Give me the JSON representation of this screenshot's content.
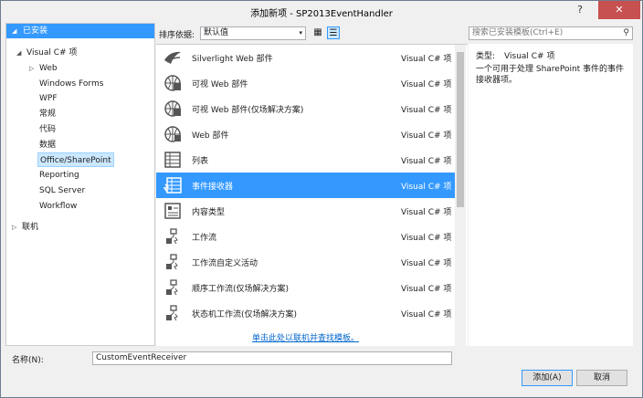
{
  "window": {
    "title": "添加新项 - SP2013EventHandler",
    "help": "?",
    "close": "✕"
  },
  "tree": {
    "installed": "已安装",
    "items": [
      {
        "label": "Visual C# 项",
        "expand": "◢"
      },
      {
        "label": "Web",
        "expand": "▷"
      },
      {
        "label": "Windows Forms"
      },
      {
        "label": "WPF"
      },
      {
        "label": "常规"
      },
      {
        "label": "代码"
      },
      {
        "label": "数据"
      },
      {
        "label": "Office/SharePoint"
      },
      {
        "label": "Reporting"
      },
      {
        "label": "SQL Server"
      },
      {
        "label": "Workflow"
      }
    ],
    "online": "联机",
    "online_expand": "▷"
  },
  "toolbar": {
    "sort_label": "排序依据:",
    "sort_value": "默认值",
    "sort_dropdown": "▾",
    "grid_view": "▦",
    "list_view": "☰",
    "search_placeholder": "搜索已安装模板(Ctrl+E)",
    "search_icon": "⚲"
  },
  "templates": [
    {
      "name": "Silverlight Web 部件",
      "lang": "Visual C# 项",
      "icon": "silverlight-webpart-icon"
    },
    {
      "name": "可视 Web 部件",
      "lang": "Visual C# 项",
      "icon": "visual-webpart-icon"
    },
    {
      "name": "可视 Web 部件(仅场解决方案)",
      "lang": "Visual C# 项",
      "icon": "visual-webpart-farm-icon"
    },
    {
      "name": "Web 部件",
      "lang": "Visual C# 项",
      "icon": "webpart-icon"
    },
    {
      "name": "列表",
      "lang": "Visual C# 项",
      "icon": "list-icon"
    },
    {
      "name": "事件接收器",
      "lang": "Visual C# 项",
      "icon": "event-receiver-icon"
    },
    {
      "name": "内容类型",
      "lang": "Visual C# 项",
      "icon": "content-type-icon"
    },
    {
      "name": "工作流",
      "lang": "Visual C# 项",
      "icon": "workflow-icon"
    },
    {
      "name": "工作流自定义活动",
      "lang": "Visual C# 项",
      "icon": "workflow-activity-icon"
    },
    {
      "name": "顺序工作流(仅场解决方案)",
      "lang": "Visual C# 项",
      "icon": "sequential-workflow-icon"
    },
    {
      "name": "状态机工作流(仅场解决方案)",
      "lang": "Visual C# 项",
      "icon": "state-machine-workflow-icon"
    }
  ],
  "online_link": "单击此处以联机并查找模板。",
  "details": {
    "type_label": "类型:",
    "type_value": "Visual C# 项",
    "description": "一个可用于处理 SharePoint 事件的事件接收器项。"
  },
  "name_field": {
    "label": "名称(N):",
    "value": "CustomEventReceiver"
  },
  "buttons": {
    "add": "添加(A)",
    "cancel": "取消"
  },
  "colors": {
    "selection": "#3399ff",
    "tree_selected": "#cce8ff",
    "link": "#0066cc"
  }
}
